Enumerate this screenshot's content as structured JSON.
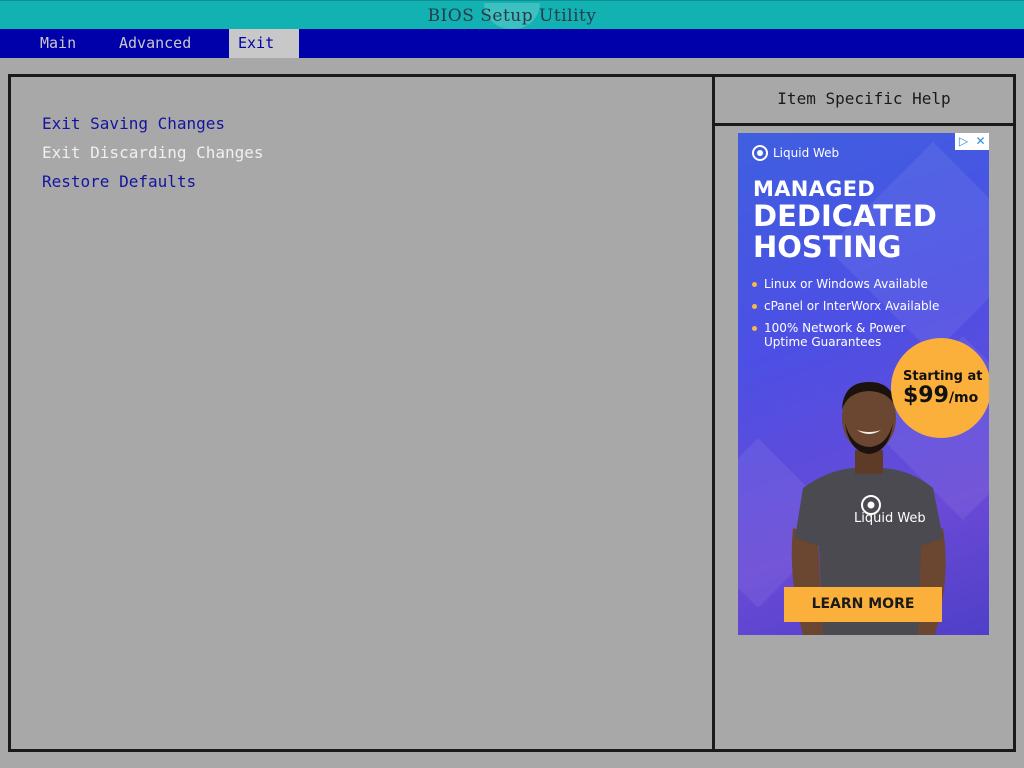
{
  "window": {
    "title": "BIOS Setup Utility"
  },
  "menu": {
    "tabs": [
      {
        "label": "Main"
      },
      {
        "label": "Advanced"
      },
      {
        "label": "Exit"
      }
    ],
    "active_tab": "Exit"
  },
  "exit_panel": {
    "options": [
      {
        "label": "Exit Saving Changes"
      },
      {
        "label": "Exit Discarding Changes"
      },
      {
        "label": "Restore Defaults"
      }
    ],
    "selected_option": "Exit Discarding Changes"
  },
  "help_panel": {
    "title": "Item Specific Help"
  },
  "ad": {
    "brand": "Liquid Web",
    "headline_1": "MANAGED",
    "headline_2": "DEDICATED",
    "headline_3": "HOSTING",
    "bullets": [
      "Linux or Windows Available",
      "cPanel or InterWorx Available",
      "100% Network & Power Uptime Guarantees"
    ],
    "price_prefix": "Starting at",
    "price": "$99",
    "price_suffix": "/mo",
    "shirt_brand": "Liquid Web",
    "cta": "LEARN MORE",
    "controls": {
      "info": "▷",
      "close": "✕"
    }
  },
  "colors": {
    "title_bar": "#12b2b2",
    "menu_bar": "#0000aa",
    "panel_bg": "#a8a8a8",
    "option_text": "#1414a0",
    "selected_text": "#f0f0f0",
    "ad_accent": "#fbb03b"
  }
}
